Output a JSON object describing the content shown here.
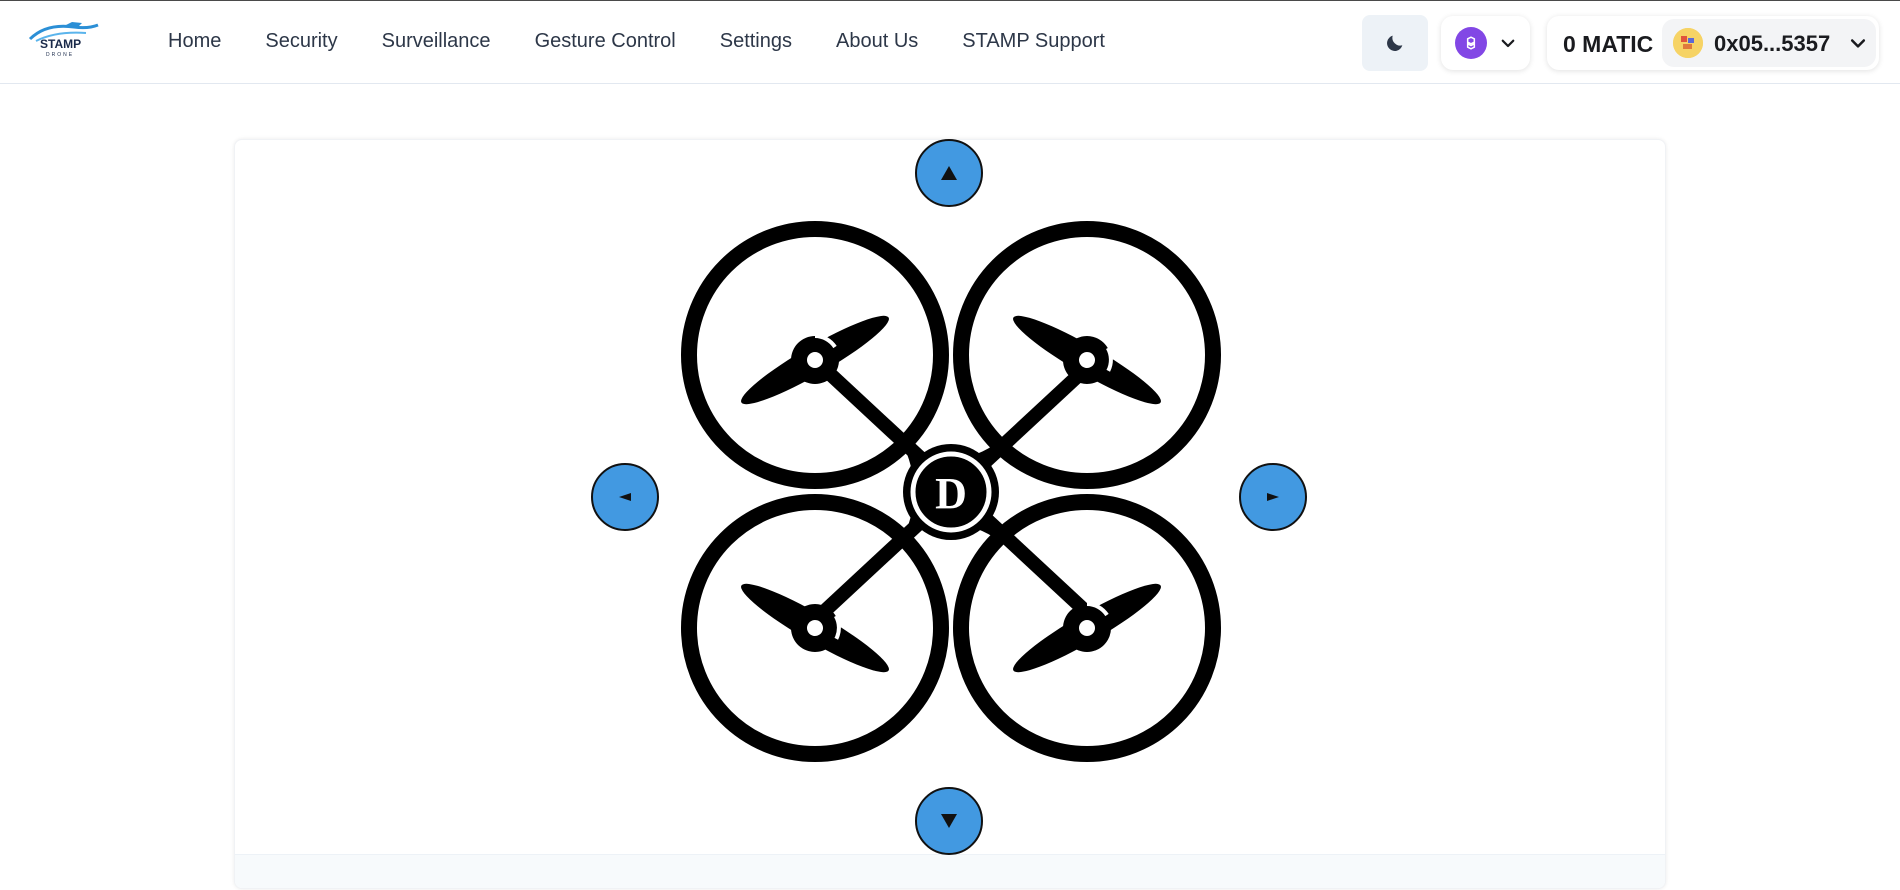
{
  "brand": {
    "logo_text": "STAMP",
    "logo_subtext": "DRONE"
  },
  "nav": {
    "items": [
      {
        "label": "Home",
        "name": "nav-home"
      },
      {
        "label": "Security",
        "name": "nav-security"
      },
      {
        "label": "Surveillance",
        "name": "nav-surveillance"
      },
      {
        "label": "Gesture Control",
        "name": "nav-gesture-control"
      },
      {
        "label": "Settings",
        "name": "nav-settings"
      },
      {
        "label": "About Us",
        "name": "nav-about-us"
      },
      {
        "label": "STAMP Support",
        "name": "nav-stamp-support"
      }
    ]
  },
  "header": {
    "theme_icon": "moon-icon",
    "chain_icon": "polygon-icon",
    "balance": "0 MATIC",
    "address": "0x05...5357"
  },
  "controller": {
    "center_letter": "D",
    "up_icon": "arrow-up-icon",
    "down_icon": "arrow-down-icon",
    "left_icon": "arrow-left-icon",
    "right_icon": "arrow-right-icon"
  },
  "colors": {
    "accent": "#4299e1",
    "chain": "#8247e5",
    "text": "#2d3748"
  }
}
